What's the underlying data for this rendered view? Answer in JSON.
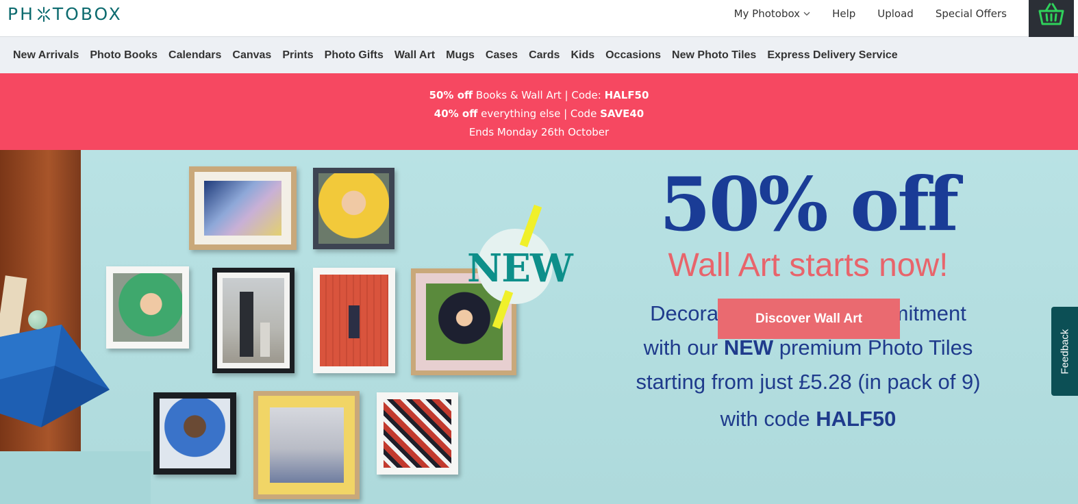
{
  "brand": {
    "logo_left": "PH",
    "logo_right": "TOBOX"
  },
  "topnav": {
    "my_photobox": "My Photobox",
    "help": "Help",
    "upload": "Upload",
    "special_offers": "Special Offers"
  },
  "categories": [
    "New Arrivals",
    "Photo Books",
    "Calendars",
    "Canvas",
    "Prints",
    "Photo Gifts",
    "Wall Art",
    "Mugs",
    "Cases",
    "Cards",
    "Kids",
    "Occasions",
    "New Photo Tiles",
    "Express Delivery Service"
  ],
  "promo": {
    "line1_bold": "50% off",
    "line1_text": " Books & Wall Art | Code: ",
    "line1_code": "HALF50",
    "line2_bold": "40% off",
    "line2_text": " everything else | Code ",
    "line2_code": "SAVE40",
    "line3": "Ends Monday 26th October"
  },
  "hero": {
    "badge": "NEW",
    "headline": "50% off",
    "subheadline": "Wall Art starts now!",
    "desc_line1": "Decorate without the commitment",
    "desc_line2_pre": "with our ",
    "desc_line2_bold": "NEW",
    "desc_line2_post": " premium Photo Tiles",
    "desc_line3": "starting from just £5.28 (in pack of 9)",
    "code_pre": "with code ",
    "code_bold": "HALF50",
    "cta": "Discover Wall Art"
  },
  "feedback": "Feedback",
  "colors": {
    "brand_teal": "#0d6b6f",
    "promo_bg": "#f64861",
    "hero_bg": "#b7e0e2",
    "headline_blue": "#1a3c96",
    "sub_coral": "#e8646b",
    "cta_bg": "#ea6a70",
    "feedback_bg": "#0c4f55",
    "basket_green": "#2fd15b"
  },
  "icons": {
    "basket": "basket-icon",
    "chevron": "chevron-down-icon",
    "logo_spark": "spark-icon"
  }
}
